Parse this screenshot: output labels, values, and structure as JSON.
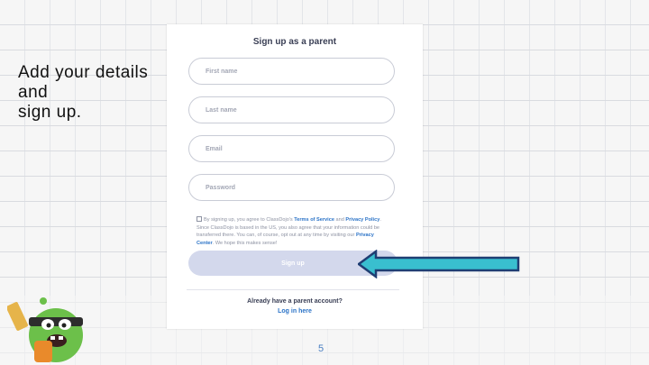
{
  "slide": {
    "caption_lines": [
      "Add your details",
      "and",
      "sign up."
    ],
    "page_number": "5"
  },
  "form": {
    "title": "Sign up as a parent",
    "fields": {
      "first_name_placeholder": "First name",
      "last_name_placeholder": "Last name",
      "email_placeholder": "Email",
      "password_placeholder": "Password"
    },
    "terms": {
      "text_1": "By signing up, you agree to ClassDojo's ",
      "terms_link": "Terms of Service",
      "text_2": " and ",
      "privacy_link": "Privacy Policy",
      "text_3": ". Since ClassDojo is based in the US, you also agree that your information could be transferred there. You can, of course, opt out at any time by visiting our ",
      "privacy_center_link": "Privacy Center",
      "text_4": ". We hope this makes sense!"
    },
    "signup_button_label": "Sign up",
    "already_text": "Already have a parent account?",
    "login_link_label": "Log in here"
  },
  "colors": {
    "arrow_fill": "#39bfcf",
    "arrow_stroke": "#1f3e73",
    "link": "#2b73c7",
    "button_disabled": "#d3d8ec"
  }
}
